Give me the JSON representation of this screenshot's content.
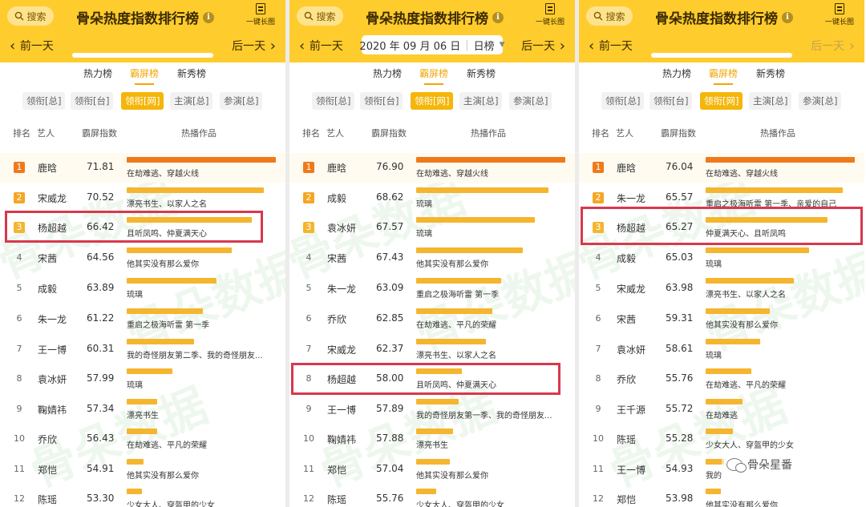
{
  "common": {
    "search_label": "搜索",
    "app_title": "骨朵热度指数排行榜",
    "onekey_label": "一键长图",
    "prev_label": "前一天",
    "next_label": "后一天",
    "tabs": [
      "热力榜",
      "霸屏榜",
      "新秀榜"
    ],
    "active_tab": 1,
    "chips": [
      "领衔[总]",
      "领衔[台]",
      "领衔[网]",
      "主演[总]",
      "参演[总]"
    ],
    "active_chip": 2,
    "headers": {
      "rank": "排名",
      "artist": "艺人",
      "score": "霸屏指数",
      "works": "热播作品"
    },
    "watermark": "骨朵数据",
    "colors": {
      "topbar": "#ffcc2e",
      "accent": "#f0a500",
      "bar_top": "#ef7a1a",
      "bar_rest": "#f5b52e",
      "highlight": "#d8384d"
    }
  },
  "panels": [
    {
      "date_text": "",
      "highlight_index": 2,
      "rows": [
        {
          "rank": "1",
          "artist": "鹿晗",
          "score": "71.81",
          "works": "在劫难逃、穿越火线",
          "bar": 0.98
        },
        {
          "rank": "2",
          "artist": "宋威龙",
          "score": "70.52",
          "works": "漂亮书生、以家人之名",
          "bar": 0.9
        },
        {
          "rank": "3",
          "artist": "杨超越",
          "score": "66.42",
          "works": "且听凤鸣、仲夏满天心",
          "bar": 0.82
        },
        {
          "rank": "4",
          "artist": "宋茜",
          "score": "64.56",
          "works": "他其实没有那么爱你",
          "bar": 0.69
        },
        {
          "rank": "5",
          "artist": "成毅",
          "score": "63.89",
          "works": "琉璃",
          "bar": 0.59
        },
        {
          "rank": "6",
          "artist": "朱一龙",
          "score": "61.22",
          "works": "重启之极海听雷 第一季",
          "bar": 0.5
        },
        {
          "rank": "7",
          "artist": "王一博",
          "score": "60.31",
          "works": "我的奇怪朋友第二季、我的奇怪朋友...",
          "bar": 0.44
        },
        {
          "rank": "8",
          "artist": "袁冰妍",
          "score": "57.99",
          "works": "琉璃",
          "bar": 0.3
        },
        {
          "rank": "9",
          "artist": "鞠婧祎",
          "score": "57.34",
          "works": "漂亮书生",
          "bar": 0.2
        },
        {
          "rank": "10",
          "artist": "乔欣",
          "score": "56.43",
          "works": "在劫难逃、平凡的荣耀",
          "bar": 0.2
        },
        {
          "rank": "11",
          "artist": "郑恺",
          "score": "54.91",
          "works": "他其实没有那么爱你",
          "bar": 0.11
        },
        {
          "rank": "12",
          "artist": "陈瑶",
          "score": "53.30",
          "works": "少女大人、穿盔甲的少女",
          "bar": 0.1
        }
      ]
    },
    {
      "date_text": "2020 年 09 月 06 日",
      "date_type": "日榜",
      "highlight_index": 7,
      "rows": [
        {
          "rank": "1",
          "artist": "鹿晗",
          "score": "76.90",
          "works": "在劫难逃、穿越火线",
          "bar": 0.98
        },
        {
          "rank": "2",
          "artist": "成毅",
          "score": "68.62",
          "works": "琉璃",
          "bar": 0.87
        },
        {
          "rank": "3",
          "artist": "袁冰妍",
          "score": "67.57",
          "works": "琉璃",
          "bar": 0.78
        },
        {
          "rank": "4",
          "artist": "宋茜",
          "score": "67.43",
          "works": "他其实没有那么爱你",
          "bar": 0.7
        },
        {
          "rank": "5",
          "artist": "朱一龙",
          "score": "63.09",
          "works": "重启之极海听雷 第一季",
          "bar": 0.56
        },
        {
          "rank": "6",
          "artist": "乔欣",
          "score": "62.85",
          "works": "在劫难逃、平凡的荣耀",
          "bar": 0.5
        },
        {
          "rank": "7",
          "artist": "宋威龙",
          "score": "62.37",
          "works": "漂亮书生、以家人之名",
          "bar": 0.46
        },
        {
          "rank": "8",
          "artist": "杨超越",
          "score": "58.00",
          "works": "且听凤鸣、仲夏满天心",
          "bar": 0.3
        },
        {
          "rank": "9",
          "artist": "王一博",
          "score": "57.89",
          "works": "我的奇怪朋友第一季、我的奇怪朋友...",
          "bar": 0.28
        },
        {
          "rank": "10",
          "artist": "鞠婧祎",
          "score": "57.88",
          "works": "漂亮书生",
          "bar": 0.24
        },
        {
          "rank": "11",
          "artist": "郑恺",
          "score": "57.04",
          "works": "他其实没有那么爱你",
          "bar": 0.22
        },
        {
          "rank": "12",
          "artist": "陈瑶",
          "score": "55.76",
          "works": "少女大人、穿盔甲的少女",
          "bar": 0.13
        }
      ]
    },
    {
      "date_text": "",
      "highlight_index": 2,
      "next_disabled": true,
      "rows": [
        {
          "rank": "1",
          "artist": "鹿晗",
          "score": "76.04",
          "works": "在劫难逃、穿越火线",
          "bar": 0.98
        },
        {
          "rank": "2",
          "artist": "朱一龙",
          "score": "65.57",
          "works": "重启之极海听雷 第一季、亲爱的自己",
          "bar": 0.9
        },
        {
          "rank": "3",
          "artist": "杨超越",
          "score": "65.27",
          "works": "仲夏满天心、且听凤鸣",
          "bar": 0.8
        },
        {
          "rank": "4",
          "artist": "成毅",
          "score": "65.03",
          "works": "琉璃",
          "bar": 0.68
        },
        {
          "rank": "5",
          "artist": "宋威龙",
          "score": "63.98",
          "works": "漂亮书生、以家人之名",
          "bar": 0.58
        },
        {
          "rank": "6",
          "artist": "宋茜",
          "score": "59.31",
          "works": "他其实没有那么爱你",
          "bar": 0.42
        },
        {
          "rank": "7",
          "artist": "袁冰妍",
          "score": "58.61",
          "works": "琉璃",
          "bar": 0.36
        },
        {
          "rank": "8",
          "artist": "乔欣",
          "score": "55.76",
          "works": "在劫难逃、平凡的荣耀",
          "bar": 0.3
        },
        {
          "rank": "9",
          "artist": "王千源",
          "score": "55.72",
          "works": "在劫难逃",
          "bar": 0.24
        },
        {
          "rank": "10",
          "artist": "陈瑶",
          "score": "55.28",
          "works": "少女大人、穿盔甲的少女",
          "bar": 0.18
        },
        {
          "rank": "11",
          "artist": "王一博",
          "score": "54.93",
          "works": "我的",
          "bar": 0.12
        },
        {
          "rank": "12",
          "artist": "郑恺",
          "score": "53.98",
          "works": "他其实没有那么爱你",
          "bar": 0.1
        }
      ]
    }
  ],
  "wechat_label": "骨朵星番"
}
